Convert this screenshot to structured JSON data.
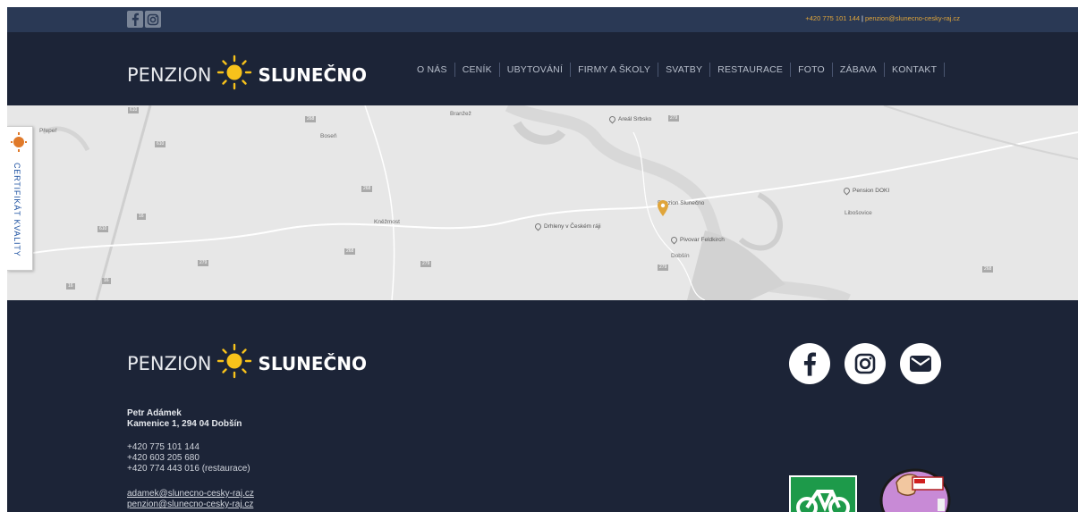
{
  "topbar": {
    "phone": "+420 775 101 144",
    "separator": "|",
    "email": "penzion@slunecno-cesky-raj.cz"
  },
  "brand": {
    "word1": "PENZION",
    "word2": "SLUNEČNO",
    "sun_color": "#f7c21b"
  },
  "nav": {
    "items": [
      "O NÁS",
      "CENÍK",
      "UBYTOVÁNÍ",
      "FIRMY A ŠKOLY",
      "SVATBY",
      "RESTAURACE",
      "FOTO",
      "ZÁBAVA",
      "KONTAKT"
    ]
  },
  "map": {
    "places": [
      "Přepeř",
      "Boseň",
      "Branžež",
      "Kněžmost",
      "Dobšín",
      "Libošovice"
    ],
    "pois": [
      "Areál Srbsko",
      "Pension DOKI",
      "Penzion Slunečno",
      "Drhleny v Českém ráji",
      "Pivovar Feldkirch"
    ],
    "roads": [
      "610",
      "268",
      "610",
      "268",
      "268",
      "610",
      "16",
      "279",
      "16",
      "279",
      "279",
      "279",
      "16",
      "268"
    ]
  },
  "certificate": {
    "label": "CERTIFIKÁT KVALITY"
  },
  "footer": {
    "name": "Petr Adámek",
    "address": "Kamenice 1, 294 04 Dobšín",
    "phones": [
      "+420 775 101 144",
      "+420 603 205 680",
      "+420 774 443 016 (restaurace)"
    ],
    "emails": [
      "adamek@slunecno-cesky-raj.cz",
      "penzion@slunecno-cesky-raj.cz"
    ]
  },
  "social": {
    "icons": [
      "facebook-icon",
      "instagram-icon",
      "mail-icon"
    ]
  },
  "colors": {
    "topbar": "#2a3955",
    "header": "#1c2437",
    "accent": "#e0a53a",
    "map": "#e7e7e7"
  }
}
